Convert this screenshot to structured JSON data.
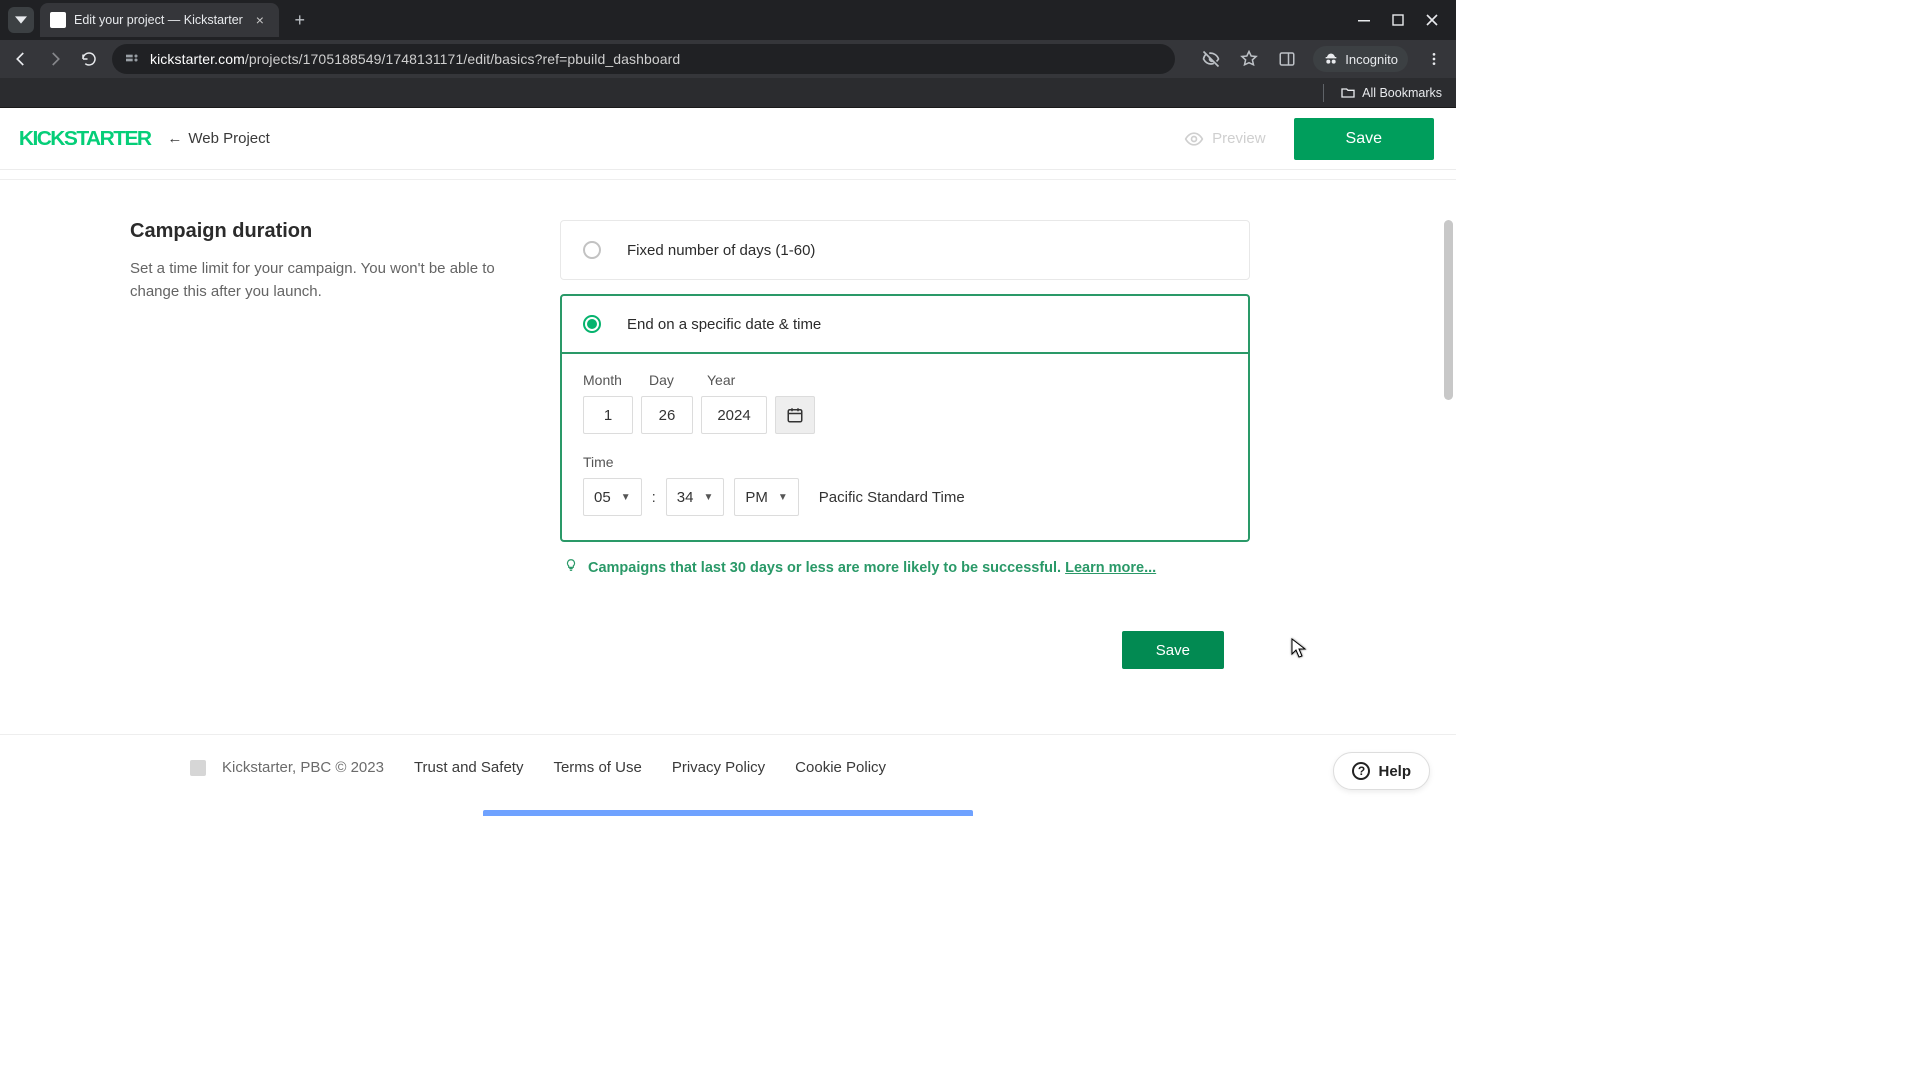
{
  "browser": {
    "tab_title": "Edit your project — Kickstarter",
    "url_host": "kickstarter.com",
    "url_path": "/projects/1705188549/1748131171/edit/basics?ref=pbuild_dashboard",
    "incognito_label": "Incognito",
    "all_bookmarks": "All Bookmarks"
  },
  "header": {
    "logo": "KICKSTARTER",
    "crumb_arrow": "←",
    "crumb_label": "Web Project",
    "preview_label": "Preview",
    "save_label": "Save"
  },
  "duration": {
    "title": "Campaign duration",
    "desc": "Set a time limit for your campaign. You won't be able to change this after you launch.",
    "option_fixed": "Fixed number of days (1-60)",
    "option_end": "End on a specific date & time",
    "labels": {
      "month": "Month",
      "day": "Day",
      "year": "Year",
      "time": "Time"
    },
    "date": {
      "month": "1",
      "day": "26",
      "year": "2024"
    },
    "time": {
      "hour": "05",
      "minute": "34",
      "ampm": "PM",
      "tz": "Pacific Standard Time"
    },
    "tip_text": "Campaigns that last 30 days or less are more likely to be successful. ",
    "tip_link": "Learn more...",
    "save2": "Save"
  },
  "footer": {
    "copyright": "Kickstarter, PBC © 2023",
    "links": [
      "Trust and Safety",
      "Terms of Use",
      "Privacy Policy",
      "Cookie Policy"
    ]
  },
  "help": {
    "label": "Help"
  }
}
